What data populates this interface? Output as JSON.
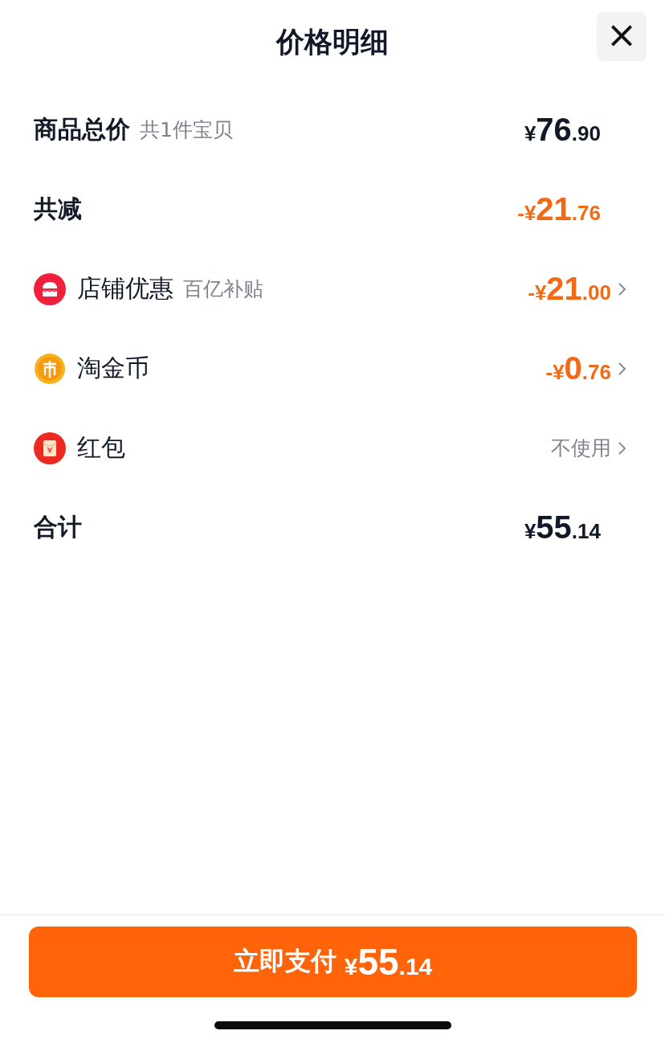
{
  "header": {
    "title": "价格明细",
    "close": "×"
  },
  "rows": [
    {
      "kind": "total",
      "label": "商品总价",
      "note": "共1件宝贝",
      "value": {
        "prefix": "¥",
        "int": "76",
        "dec": ".90"
      }
    },
    {
      "kind": "reduction",
      "label": "共减",
      "value": {
        "prefix": "-¥",
        "int": "21",
        "dec": ".76"
      }
    },
    {
      "kind": "discount",
      "label": "店铺优惠",
      "note": "百亿补贴",
      "value": {
        "prefix": "-¥",
        "int": "21",
        "dec": ".00"
      }
    },
    {
      "kind": "discount",
      "label": "淘金币",
      "value": {
        "prefix": "-¥",
        "int": "0",
        "dec": ".76"
      }
    },
    {
      "kind": "choice",
      "label": "红包",
      "value_text": "不使用"
    },
    {
      "kind": "total",
      "label": "合计",
      "value": {
        "prefix": "¥",
        "int": "55",
        "dec": ".14"
      }
    }
  ],
  "pay_button": {
    "label": "立即支付",
    "value": {
      "prefix": "¥",
      "int": "55",
      "dec": ".14"
    }
  }
}
